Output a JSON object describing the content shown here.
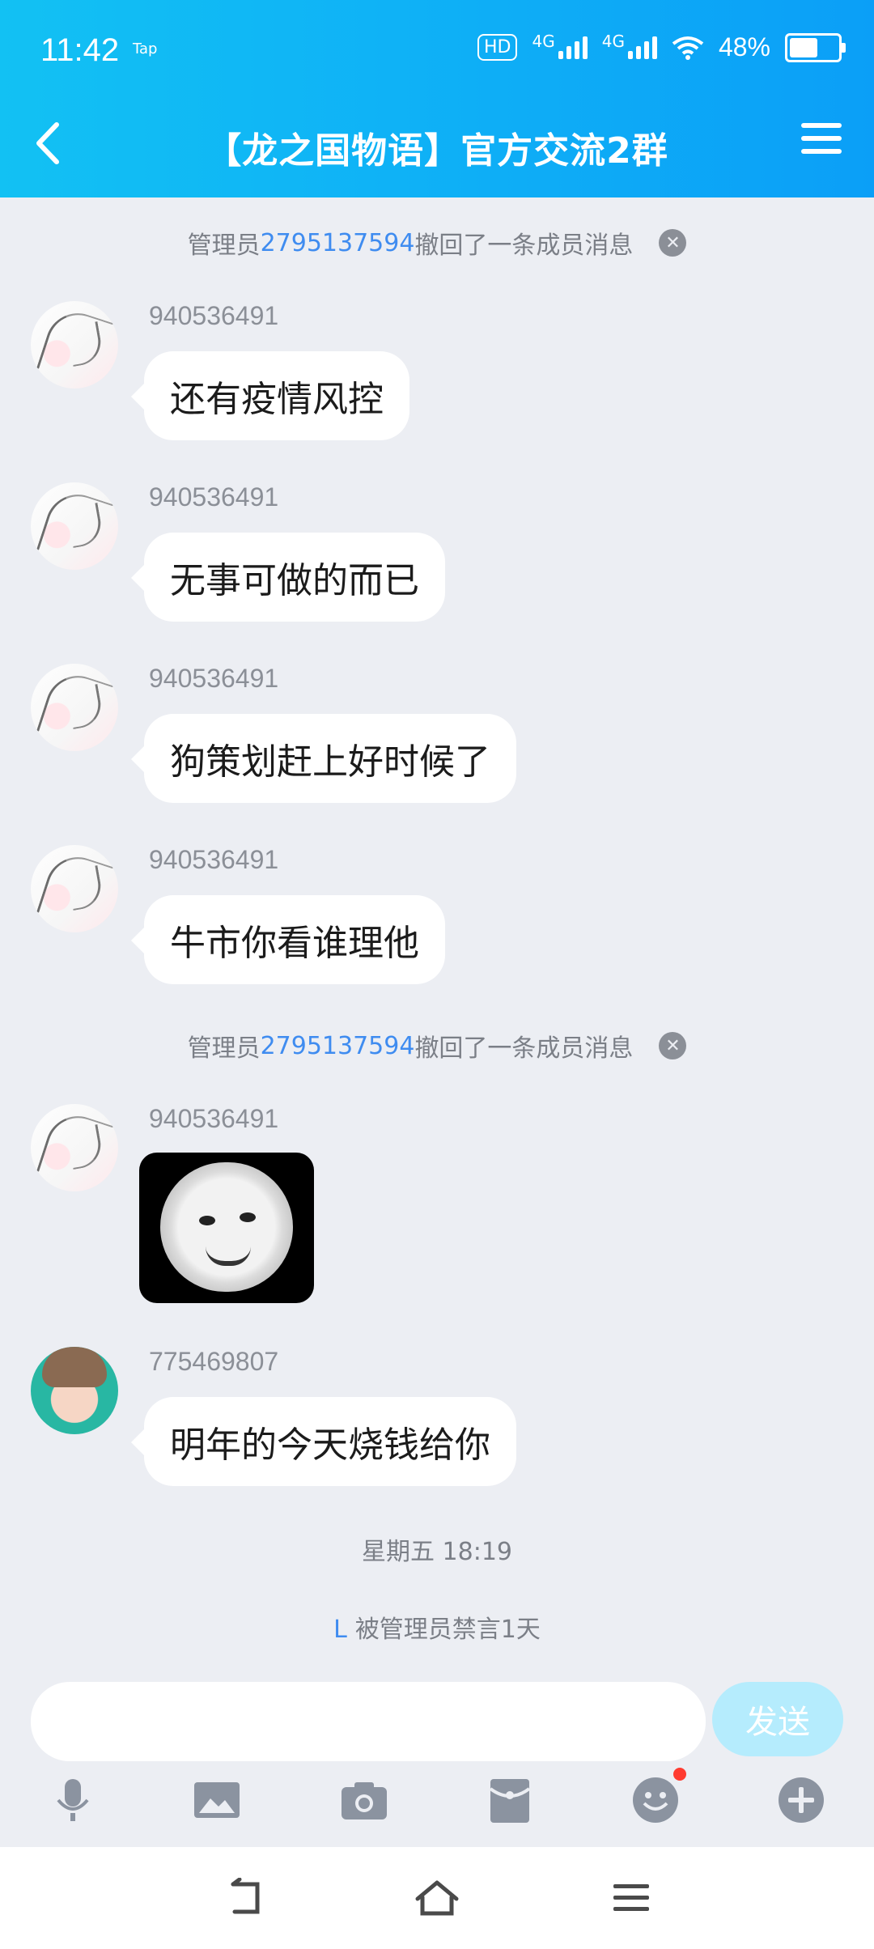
{
  "status": {
    "time": "11:42",
    "tap": "Tap",
    "hd": "HD",
    "network1": "4G",
    "network2": "4G",
    "battery": "48%"
  },
  "header": {
    "title": "【龙之国物语】官方交流2群",
    "back_icon": "chevron-left-icon",
    "menu_icon": "hamburger-menu-icon"
  },
  "messages": {
    "recall1": {
      "prefix": "管理员",
      "id": "2795137594",
      "suffix": "撤回了一条成员消息"
    },
    "m1": {
      "user": "940536491",
      "text": "还有疫情风控"
    },
    "m2": {
      "user": "940536491",
      "text": "无事可做的而已"
    },
    "m3": {
      "user": "940536491",
      "text": "狗策划赶上好时候了"
    },
    "m4": {
      "user": "940536491",
      "text": "牛市你看谁理他"
    },
    "recall2": {
      "prefix": "管理员",
      "id": "2795137594",
      "suffix": "撤回了一条成员消息"
    },
    "m5": {
      "user": "940536491"
    },
    "m6": {
      "user": "775469807",
      "text": "明年的今天烧钱给你"
    },
    "timestamp": "星期五 18:19",
    "mute": {
      "user": "L",
      "text": "被管理员禁言1天"
    }
  },
  "input": {
    "placeholder": "",
    "send_label": "发送"
  },
  "colors": {
    "accent": "#12c1f3",
    "link": "#3f8cf0",
    "background": "#eceef3"
  }
}
